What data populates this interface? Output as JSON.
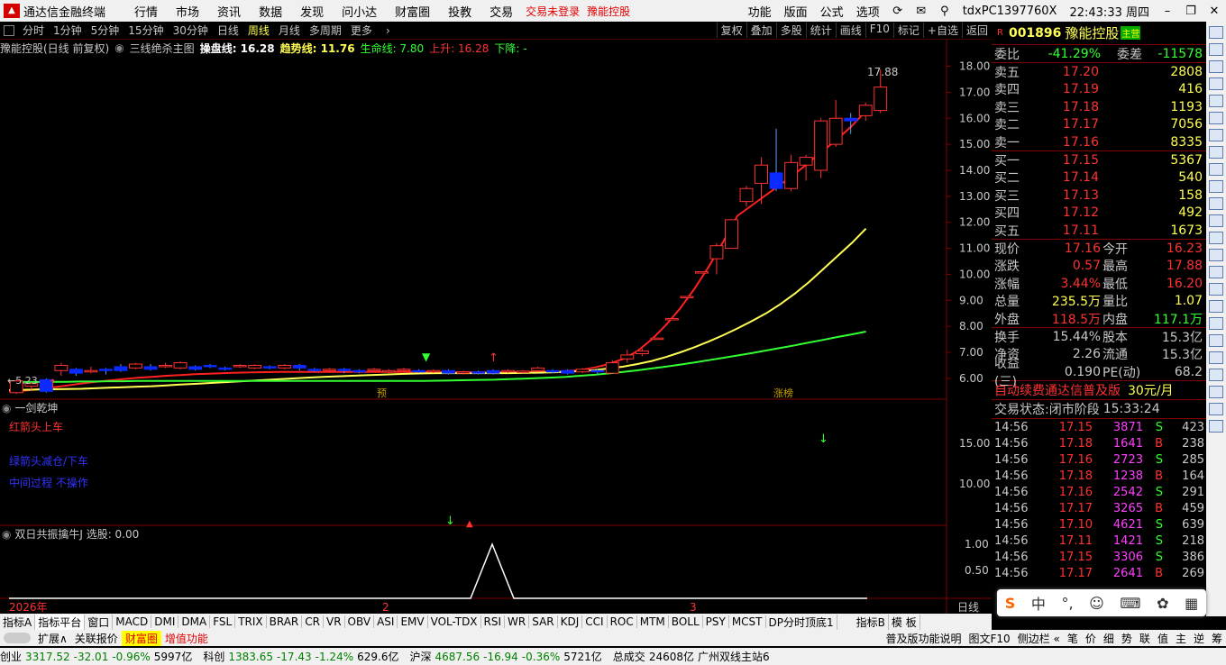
{
  "menubar": {
    "app_name": "通达信金融终端",
    "items": [
      "行情",
      "市场",
      "资讯",
      "数据",
      "发现",
      "问小达",
      "财富圈",
      "投教",
      "交易"
    ],
    "trade_status": "交易未登录",
    "stock_link": "豫能控股",
    "right_items": [
      "功能",
      "版面",
      "公式",
      "选项"
    ],
    "user": "tdxPC1397760X",
    "clock": "22:43:33 周四"
  },
  "periods": {
    "items": [
      "分时",
      "1分钟",
      "5分钟",
      "15分钟",
      "30分钟",
      "日线",
      "周线",
      "月线",
      "多周期",
      "更多"
    ],
    "active": "日线",
    "right_items": [
      "复权",
      "叠加",
      "多股",
      "统计",
      "画线",
      "F10",
      "标记",
      "+自选",
      "返回"
    ]
  },
  "chart_header": {
    "title": "豫能控股(日线 前复权)",
    "indicator": "三线绝杀主图",
    "lines": [
      {
        "label": "操盘线: 16.28",
        "color": "#ffffff"
      },
      {
        "label": "趋势线: 11.76",
        "color": "#ffff54"
      },
      {
        "label": "生命线: 7.80",
        "color": "#32ff32"
      },
      {
        "label": "上升: 16.28",
        "color": "#ff3232"
      },
      {
        "label": "下降: -",
        "color": "#32ff32"
      }
    ]
  },
  "chart_data": [
    {
      "type": "candlestick",
      "y_ticks": [
        "18.00",
        "17.00",
        "16.00",
        "15.00",
        "14.00",
        "13.00",
        "12.00",
        "11.00",
        "10.00",
        "9.00",
        "8.00",
        "7.00",
        "6.00"
      ],
      "ylim": [
        5.2,
        18.4
      ],
      "candles": [
        [
          5.45,
          5.9,
          5.4,
          5.95
        ],
        [
          5.7,
          5.8,
          5.55,
          5.85
        ],
        [
          5.95,
          5.5,
          5.45,
          6.0
        ],
        [
          6.3,
          6.5,
          6.1,
          6.6
        ],
        [
          6.35,
          6.2,
          6.1,
          6.4
        ],
        [
          6.3,
          6.3,
          6.2,
          6.45
        ],
        [
          6.35,
          6.3,
          6.15,
          6.4
        ],
        [
          6.45,
          6.3,
          6.25,
          6.55
        ],
        [
          6.4,
          6.55,
          6.35,
          6.6
        ],
        [
          6.45,
          6.35,
          6.3,
          6.55
        ],
        [
          6.45,
          6.5,
          6.4,
          6.6
        ],
        [
          6.4,
          6.6,
          6.35,
          6.65
        ],
        [
          6.45,
          6.35,
          6.3,
          6.5
        ],
        [
          6.5,
          6.45,
          6.4,
          6.55
        ],
        [
          6.4,
          6.35,
          6.3,
          6.45
        ],
        [
          6.45,
          6.5,
          6.4,
          6.55
        ],
        [
          6.4,
          6.5,
          6.35,
          6.55
        ],
        [
          6.45,
          6.4,
          6.35,
          6.5
        ],
        [
          6.4,
          6.5,
          6.35,
          6.55
        ],
        [
          6.5,
          6.4,
          6.3,
          6.55
        ],
        [
          6.35,
          6.3,
          6.25,
          6.4
        ],
        [
          6.3,
          6.35,
          6.25,
          6.4
        ],
        [
          6.35,
          6.3,
          6.2,
          6.4
        ],
        [
          6.3,
          6.25,
          6.2,
          6.35
        ],
        [
          6.3,
          6.35,
          6.25,
          6.4
        ],
        [
          6.25,
          6.3,
          6.2,
          6.35
        ],
        [
          6.3,
          6.35,
          6.25,
          6.4
        ],
        [
          6.3,
          6.25,
          6.2,
          6.35
        ],
        [
          6.25,
          6.3,
          6.2,
          6.35
        ],
        [
          6.3,
          6.2,
          6.15,
          6.35
        ],
        [
          6.2,
          6.25,
          6.15,
          6.3
        ],
        [
          6.25,
          6.2,
          6.15,
          6.3
        ],
        [
          6.3,
          6.2,
          6.15,
          6.35
        ],
        [
          6.25,
          6.3,
          6.2,
          6.35
        ],
        [
          6.25,
          6.28,
          6.2,
          6.32
        ],
        [
          6.3,
          6.4,
          6.25,
          6.45
        ],
        [
          6.3,
          6.25,
          6.2,
          6.35
        ],
        [
          6.3,
          6.2,
          6.15,
          6.35
        ],
        [
          6.25,
          6.35,
          6.2,
          6.4
        ],
        [
          6.3,
          6.25,
          6.15,
          6.35
        ],
        [
          6.2,
          6.6,
          6.2,
          6.7
        ],
        [
          6.75,
          6.9,
          6.6,
          7.1
        ],
        [
          6.95,
          7.05,
          6.85,
          7.15
        ],
        [
          7.5,
          7.55,
          7.5,
          7.55
        ],
        [
          8.25,
          8.3,
          8.25,
          8.3
        ],
        [
          9.1,
          9.15,
          9.1,
          9.15
        ],
        [
          10.05,
          10.1,
          10.05,
          10.1
        ],
        [
          10.6,
          11.1,
          10.0,
          11.2
        ],
        [
          11.0,
          12.1,
          11.0,
          12.1
        ],
        [
          12.8,
          13.3,
          12.6,
          13.4
        ],
        [
          13.5,
          14.2,
          12.7,
          14.5
        ],
        [
          13.9,
          13.3,
          13.2,
          15.6
        ],
        [
          13.3,
          14.3,
          13.2,
          14.6
        ],
        [
          14.2,
          14.5,
          13.6,
          14.6
        ],
        [
          14.0,
          15.9,
          13.7,
          16.0
        ],
        [
          15.0,
          16.0,
          14.9,
          16.7
        ],
        [
          16.0,
          15.9,
          15.4,
          16.2
        ],
        [
          16.1,
          16.5,
          15.9,
          16.6
        ],
        [
          16.3,
          17.2,
          16.2,
          17.88
        ]
      ],
      "ma_lines": [
        {
          "name": "操盘线",
          "color": "#ff2020",
          "start": 0,
          "values": [
            5.5,
            5.52,
            5.58,
            5.65,
            5.72,
            5.8,
            5.86,
            5.92,
            5.97,
            6.02,
            6.06,
            6.1,
            6.13,
            6.16,
            6.18,
            6.2,
            6.22,
            6.23,
            6.24,
            6.25,
            6.25,
            6.25,
            6.25,
            6.25,
            6.25,
            6.25,
            6.25,
            6.25,
            6.25,
            6.25,
            6.24,
            6.23,
            6.23,
            6.23,
            6.24,
            6.24,
            6.25,
            6.25,
            6.26,
            6.28,
            6.32,
            6.42,
            6.55,
            6.75,
            7.05,
            7.5,
            8.05,
            8.7,
            9.45,
            10.3,
            11.25,
            12.25,
            12.65,
            13.05,
            13.45,
            13.85,
            14.3,
            14.75,
            15.2,
            15.7,
            16.28
          ]
        },
        {
          "name": "趋势线",
          "color": "#ffff54",
          "start": 0,
          "values": [
            5.55,
            5.56,
            5.57,
            5.58,
            5.59,
            5.6,
            5.62,
            5.64,
            5.66,
            5.68,
            5.7,
            5.73,
            5.76,
            5.79,
            5.82,
            5.85,
            5.88,
            5.91,
            5.94,
            5.97,
            6.0,
            6.03,
            6.06,
            6.08,
            6.1,
            6.12,
            6.14,
            6.16,
            6.18,
            6.19,
            6.2,
            6.2,
            6.2,
            6.2,
            6.2,
            6.2,
            6.21,
            6.22,
            6.23,
            6.25,
            6.28,
            6.32,
            6.38,
            6.45,
            6.55,
            6.67,
            6.82,
            7.0,
            7.2,
            7.42,
            7.66,
            7.92,
            8.2,
            8.5,
            8.85,
            9.25,
            9.7,
            10.2,
            10.7,
            11.2,
            11.76
          ]
        },
        {
          "name": "生命线",
          "color": "#32ff32",
          "start": 0,
          "values": [
            5.85,
            5.86,
            5.86,
            5.87,
            5.87,
            5.88,
            5.88,
            5.89,
            5.89,
            5.9,
            5.9,
            5.9,
            5.9,
            5.9,
            5.9,
            5.9,
            5.9,
            5.9,
            5.9,
            5.9,
            5.9,
            5.9,
            5.9,
            5.9,
            5.9,
            5.9,
            5.9,
            5.9,
            5.9,
            5.9,
            5.91,
            5.92,
            5.93,
            5.94,
            5.95,
            5.97,
            5.99,
            6.01,
            6.03,
            6.06,
            6.1,
            6.14,
            6.19,
            6.25,
            6.31,
            6.38,
            6.45,
            6.53,
            6.61,
            6.7,
            6.79,
            6.88,
            6.97,
            7.07,
            7.17,
            7.27,
            7.38,
            7.48,
            7.59,
            7.69,
            7.8
          ]
        }
      ],
      "annotations": {
        "low_label": "5.23",
        "high_label": "17.88",
        "tag_pre": "预",
        "tag_limit": "涨榜"
      }
    },
    {
      "type": "indicator",
      "title": "一剑乾坤",
      "legend": [
        {
          "text": "红箭头上车",
          "color": "#ff3232"
        },
        {
          "text": "绿箭头减仓/下车",
          "color": "#3232ff"
        },
        {
          "text": "中间过程 不操作",
          "color": "#3232ff"
        }
      ],
      "y_ticks": [
        "15.00",
        "10.00"
      ]
    },
    {
      "type": "line",
      "title": "双日共振擒牛J",
      "subtitle": "选股: 0.00",
      "y_ticks": [
        "1.00",
        "0.50"
      ],
      "x_labels": [
        "2026年",
        "2",
        "3"
      ],
      "period_label": "日线"
    }
  ],
  "right_panel": {
    "code": "001896",
    "name": "豫能控股",
    "name_badge": "主营",
    "weibi_label": "委比",
    "weibi": "-41.29%",
    "weicha_label": "委差",
    "weicha": "-11578",
    "sell": [
      {
        "label": "卖五",
        "price": "17.20",
        "vol": "2808"
      },
      {
        "label": "卖四",
        "price": "17.19",
        "vol": "416"
      },
      {
        "label": "卖三",
        "price": "17.18",
        "vol": "1193"
      },
      {
        "label": "卖二",
        "price": "17.17",
        "vol": "7056"
      },
      {
        "label": "卖一",
        "price": "17.16",
        "vol": "8335"
      }
    ],
    "buy": [
      {
        "label": "买一",
        "price": "17.15",
        "vol": "5367"
      },
      {
        "label": "买二",
        "price": "17.14",
        "vol": "540"
      },
      {
        "label": "买三",
        "price": "17.13",
        "vol": "158"
      },
      {
        "label": "买四",
        "price": "17.12",
        "vol": "492"
      },
      {
        "label": "买五",
        "price": "17.11",
        "vol": "1673"
      }
    ],
    "stats": [
      [
        "现价",
        "17.16",
        "今开",
        "16.23"
      ],
      [
        "涨跌",
        "0.57",
        "最高",
        "17.88"
      ],
      [
        "涨幅",
        "3.44%",
        "最低",
        "16.20"
      ],
      [
        "总量",
        "235.5万",
        "量比",
        "1.07"
      ],
      [
        "外盘",
        "118.5万",
        "内盘",
        "117.1万"
      ]
    ],
    "stats2": [
      [
        "换手",
        "15.44%",
        "股本",
        "15.3亿"
      ],
      [
        "净资",
        "2.26",
        "流通",
        "15.3亿"
      ],
      [
        "收益(三)",
        "0.190",
        "PE(动)",
        "68.2"
      ]
    ],
    "ad_text": "自动续费通达信普及版",
    "ad_price": "30元/月",
    "trade_state_label": "交易状态:",
    "trade_state": "闭市阶段",
    "trade_time": "15:33:24",
    "ticks": [
      [
        "14:56",
        "17.15",
        "3871",
        "S",
        "423"
      ],
      [
        "14:56",
        "17.18",
        "1641",
        "B",
        "238"
      ],
      [
        "14:56",
        "17.16",
        "2723",
        "S",
        "285"
      ],
      [
        "14:56",
        "17.18",
        "1238",
        "B",
        "164"
      ],
      [
        "14:56",
        "17.16",
        "2542",
        "S",
        "291"
      ],
      [
        "14:56",
        "17.17",
        "3265",
        "B",
        "459"
      ],
      [
        "14:56",
        "17.10",
        "4621",
        "S",
        "639"
      ],
      [
        "14:56",
        "17.11",
        "1421",
        "S",
        "218"
      ],
      [
        "14:56",
        "17.15",
        "3306",
        "S",
        "386"
      ],
      [
        "14:56",
        "17.17",
        "2641",
        "B",
        "269"
      ]
    ]
  },
  "indicator_tabs": [
    "指标A",
    "指标平台",
    "窗口",
    "MACD",
    "DMI",
    "DMA",
    "FSL",
    "TRIX",
    "BRAR",
    "CR",
    "VR",
    "OBV",
    "ASI",
    "EMV",
    "VOL-TDX",
    "RSI",
    "WR",
    "SAR",
    "KDJ",
    "CCI",
    "ROC",
    "MTM",
    "BOLL",
    "PSY",
    "MCST",
    "DP分时顶底1",
    "指标B",
    "模 板"
  ],
  "ext_bar": {
    "left": [
      "扩展∧",
      "关联报价",
      "财富圈",
      "增值功能"
    ],
    "right": [
      "普及版功能说明",
      "图文F10",
      "侧边栏 «",
      "笔",
      "价",
      "细",
      "势",
      "联",
      "值",
      "主",
      "逆",
      "筹"
    ]
  },
  "status_bar": {
    "items": [
      {
        "name": "创业",
        "val": "3317.52",
        "chg": "-32.01",
        "pct": "-0.96%",
        "amt": "5997亿"
      },
      {
        "name": "科创",
        "val": "1383.65",
        "chg": "-17.43",
        "pct": "-1.24%",
        "amt": "629.6亿"
      },
      {
        "name": "沪深",
        "val": "4687.56",
        "chg": "-16.94",
        "pct": "-0.36%",
        "amt": "5721亿"
      }
    ],
    "total_label": "总成交",
    "total": "24608亿",
    "server": "广州双线主站6"
  },
  "ime": [
    "S",
    "中",
    "°,",
    "☺",
    "⌨",
    "✿",
    "▦"
  ]
}
